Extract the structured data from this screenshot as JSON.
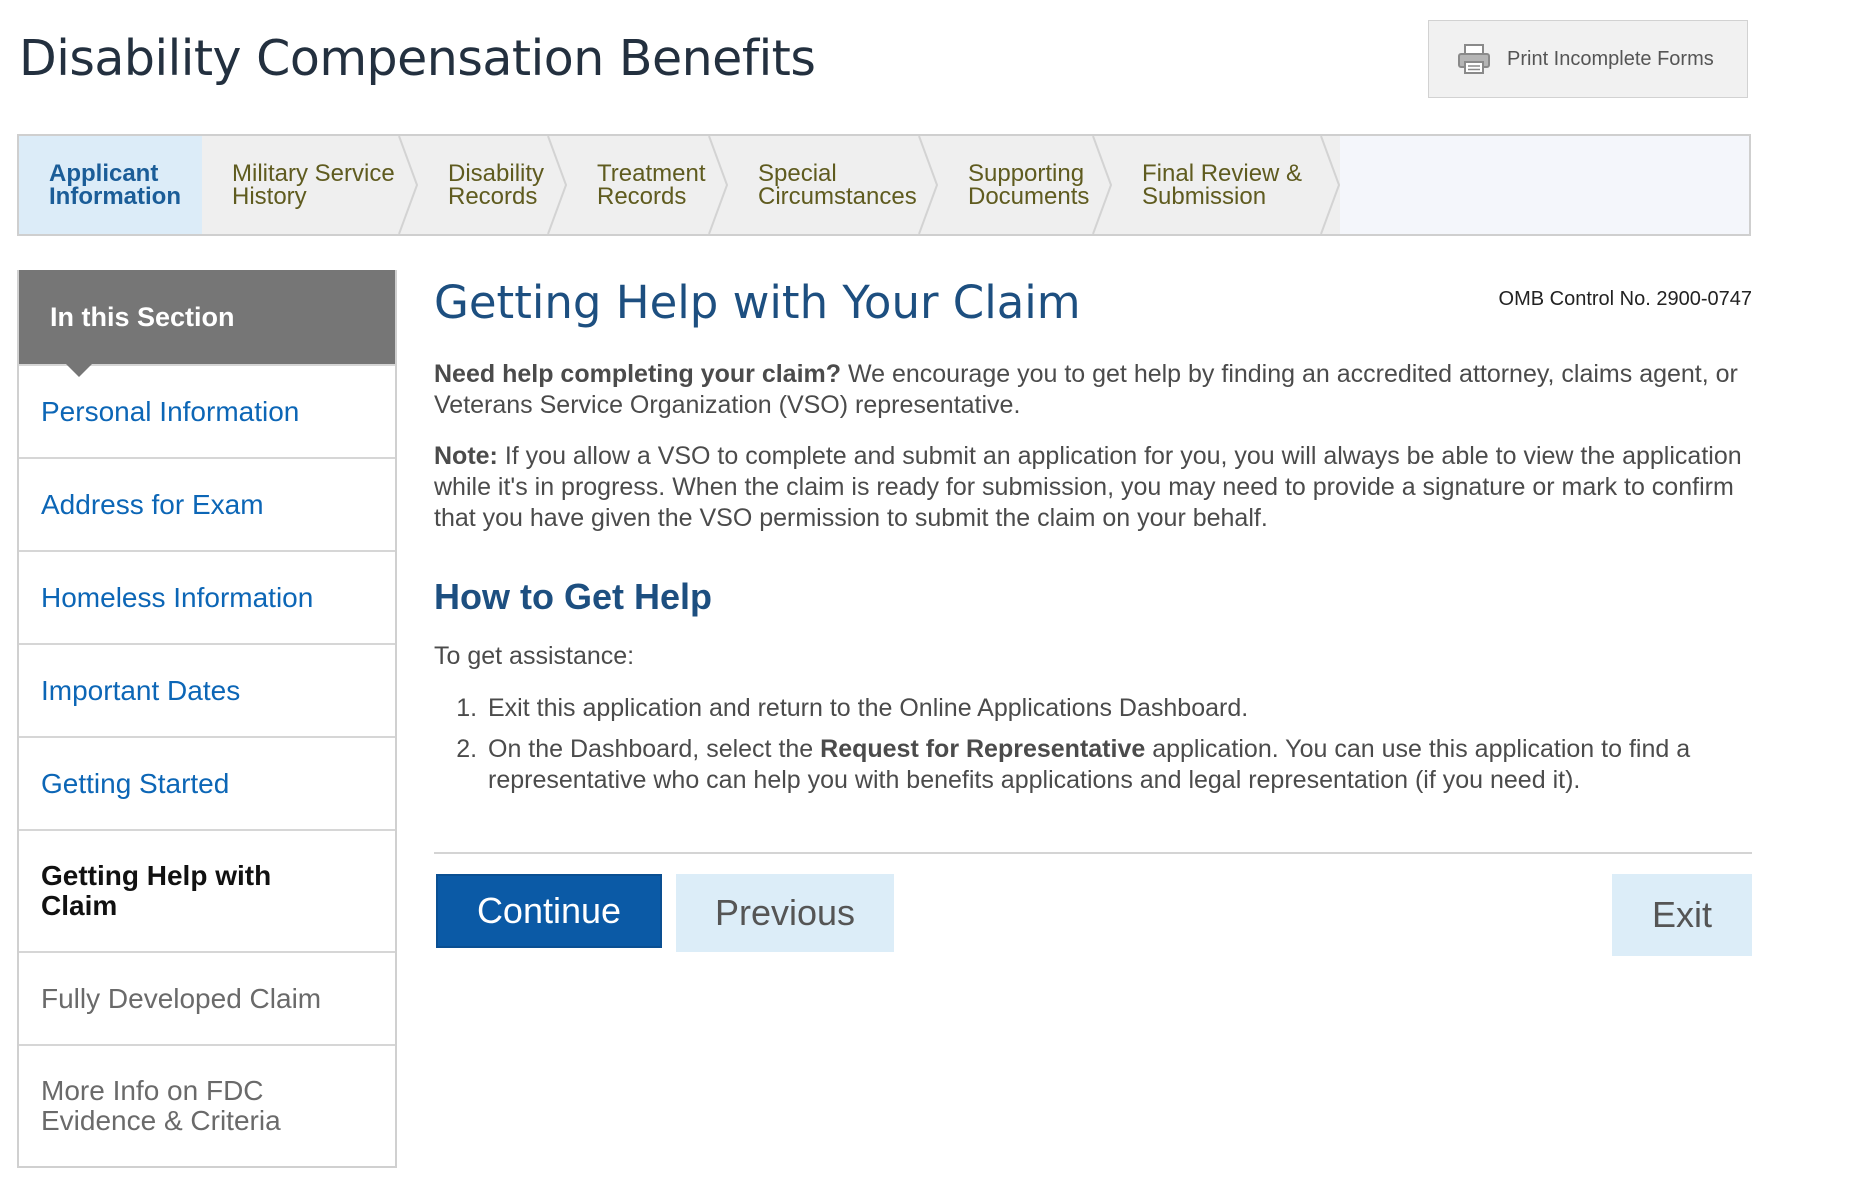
{
  "header": {
    "title": "Disability Compensation Benefits",
    "print_label": "Print Incomplete Forms",
    "print_icon": "printer-icon"
  },
  "tabs": [
    {
      "label": "Applicant\nInformation",
      "active": true
    },
    {
      "label": "Military Service\nHistory",
      "active": false
    },
    {
      "label": "Disability\nRecords",
      "active": false
    },
    {
      "label": "Treatment\nRecords",
      "active": false
    },
    {
      "label": "Special\nCircumstances",
      "active": false
    },
    {
      "label": "Supporting\nDocuments",
      "active": false
    },
    {
      "label": "Final Review &\nSubmission",
      "active": false
    }
  ],
  "sidebar": {
    "heading": "In this Section",
    "items": [
      {
        "label": "Personal Information"
      },
      {
        "label": "Address for Exam"
      },
      {
        "label": "Homeless Information"
      },
      {
        "label": "Important Dates"
      },
      {
        "label": "Getting Started"
      },
      {
        "label": "Getting Help with Claim"
      },
      {
        "label": "Fully Developed Claim"
      },
      {
        "label": "More Info on FDC Evidence & Criteria"
      }
    ]
  },
  "main": {
    "omb": "OMB Control No. 2900-0747",
    "title": "Getting Help with Your Claim",
    "para1_bold": "Need help completing your claim?",
    "para1_text": " We encourage you to get help by finding an accredited attorney, claims agent, or Veterans Service Organization (VSO) representative.",
    "note_bold": "Note:",
    "note_text": " If you allow a VSO to complete and submit an application for you, you will always be able to view the application while it's in progress. When the claim is ready for submission, you may need to provide a signature or mark to confirm that you have given the VSO permission to submit the claim on your behalf.",
    "subheading": "How to Get Help",
    "intro": "To get assistance:",
    "step1": "Exit this application and return to the Online Applications Dashboard.",
    "step2_pre": "On the Dashboard, select the ",
    "step2_bold": "Request for Representative",
    "step2_post": " application. You can use this application to find a representative who can help you with benefits applications and legal representation (if you need it)."
  },
  "buttons": {
    "continue": "Continue",
    "previous": "Previous",
    "exit": "Exit"
  },
  "colors": {
    "accent": "#0b5aa6",
    "heading": "#1d4f80",
    "link": "#0c66b6",
    "sidebar_head": "#767676"
  }
}
